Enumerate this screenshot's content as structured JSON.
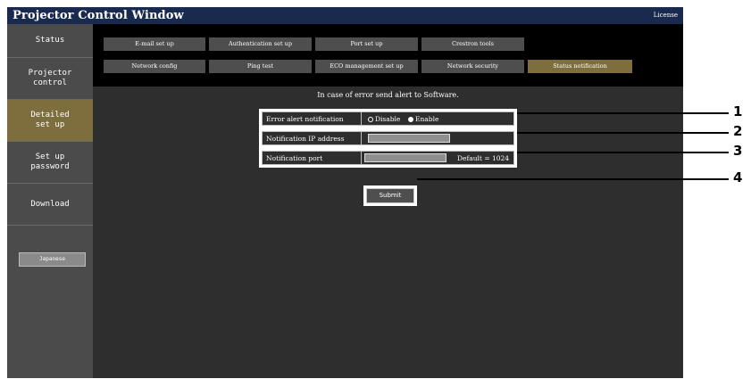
{
  "window": {
    "title": "Projector Control Window",
    "license_link": "License"
  },
  "sidebar": {
    "items": [
      {
        "label": "Status"
      },
      {
        "label": "Projector control"
      },
      {
        "label": "Detailed set up",
        "active": true
      },
      {
        "label": "Set up password"
      },
      {
        "label": "Download"
      }
    ],
    "language_button": "Japanese"
  },
  "tabs": {
    "row1": [
      "E-mail set up",
      "Authentication set up",
      "Port set up",
      "Crestron tools"
    ],
    "row2": [
      "Network config",
      "Ping test",
      "ECO management set up",
      "Network security",
      "Status notification"
    ],
    "active": "Status notification"
  },
  "form": {
    "instruction": "In case of error send alert to Software.",
    "error_alert": {
      "label": "Error alert notification",
      "options": [
        "Disable",
        "Enable"
      ],
      "selected": "Enable"
    },
    "ip_address": {
      "label": "Notification IP address",
      "value": ""
    },
    "port": {
      "label": "Notification port",
      "value": "",
      "default_text": "Default = 1024"
    },
    "submit_label": "Submit"
  },
  "callouts": [
    "1",
    "2",
    "3",
    "4"
  ],
  "colors": {
    "titlebar": "#1a2a4f",
    "sidebar": "#4b4b4b",
    "active": "#7e6e3e",
    "panel": "#2e2e2e"
  }
}
